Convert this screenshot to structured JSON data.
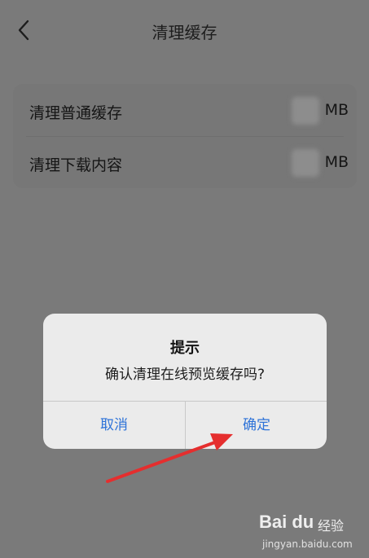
{
  "header": {
    "title": "清理缓存"
  },
  "cache_list": [
    {
      "label": "清理普通缓存",
      "unit": "MB"
    },
    {
      "label": "清理下载内容",
      "unit": "MB"
    }
  ],
  "dialog": {
    "title": "提示",
    "message": "确认清理在线预览缓存吗?",
    "cancel_label": "取消",
    "confirm_label": "确定"
  },
  "colors": {
    "accent": "#2e73d8",
    "annotation_arrow": "#e52e2e"
  },
  "watermark": {
    "logo_text": "Bai du",
    "brand_text": "经验",
    "url_text": "jingyan.baidu.com"
  }
}
